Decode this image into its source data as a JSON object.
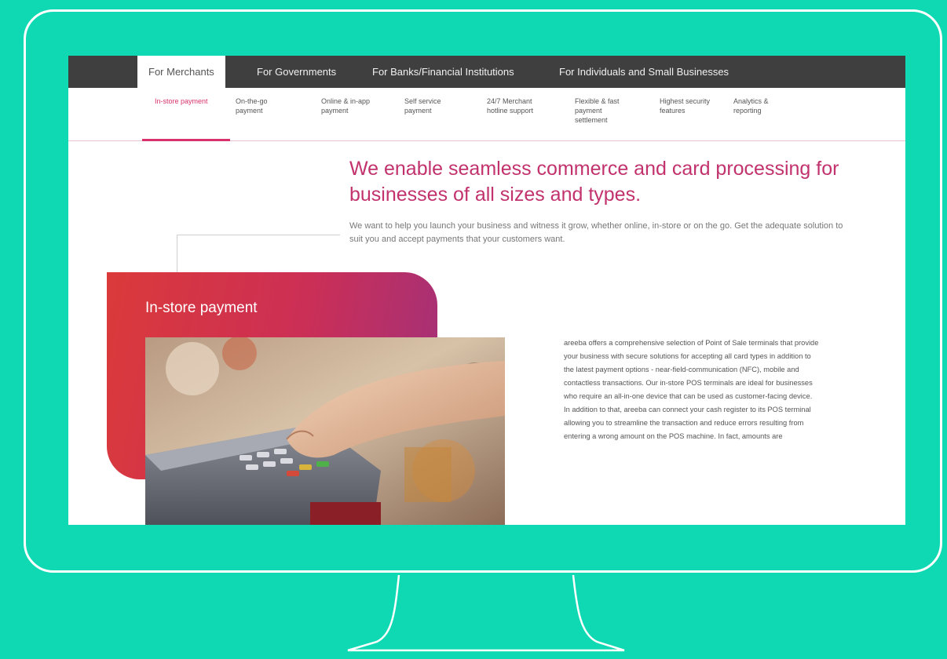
{
  "topnav": {
    "tabs": [
      {
        "label": "For Merchants",
        "active": true
      },
      {
        "label": "For Governments"
      },
      {
        "label": "For Banks/Financial Institutions"
      },
      {
        "label": "For Individuals and Small Businesses"
      }
    ]
  },
  "subnav": {
    "items": [
      {
        "label": "In-store payment",
        "active": true
      },
      {
        "label": "On-the-go payment"
      },
      {
        "label": "Online & in-app payment"
      },
      {
        "label": "Self service payment"
      },
      {
        "label": "24/7 Merchant hotline support"
      },
      {
        "label": "Flexible & fast payment settlement"
      },
      {
        "label": "Highest security features"
      },
      {
        "label": "Analytics & reporting"
      }
    ]
  },
  "hero": {
    "headline": "We enable seamless commerce and card processing for businesses of all sizes and types.",
    "intro": "We want to help you launch your business and witness it grow, whether online, in-store or on the go. Get the adequate solution to suit you and accept payments that your customers want."
  },
  "section": {
    "title": "In-store payment",
    "paragraph1": "areeba offers a comprehensive selection of Point of Sale terminals that provide your business with secure solutions for accepting all card types in addition to the latest payment options - near-field-communication (NFC), mobile and contactless transactions. Our in-store POS terminals are ideal for businesses who require an all-in-one device that can be used as customer-facing device.",
    "paragraph2": "In addition to that, areeba can connect your cash register to its POS terminal allowing you to streamline the transaction and reduce errors resulting from entering a wrong amount on the POS machine. In fact, amounts are"
  },
  "colors": {
    "background": "#0fd9b3",
    "nav_dark": "#3f3f3f",
    "accent_pink": "#d8316b",
    "headline": "#c2326d"
  }
}
